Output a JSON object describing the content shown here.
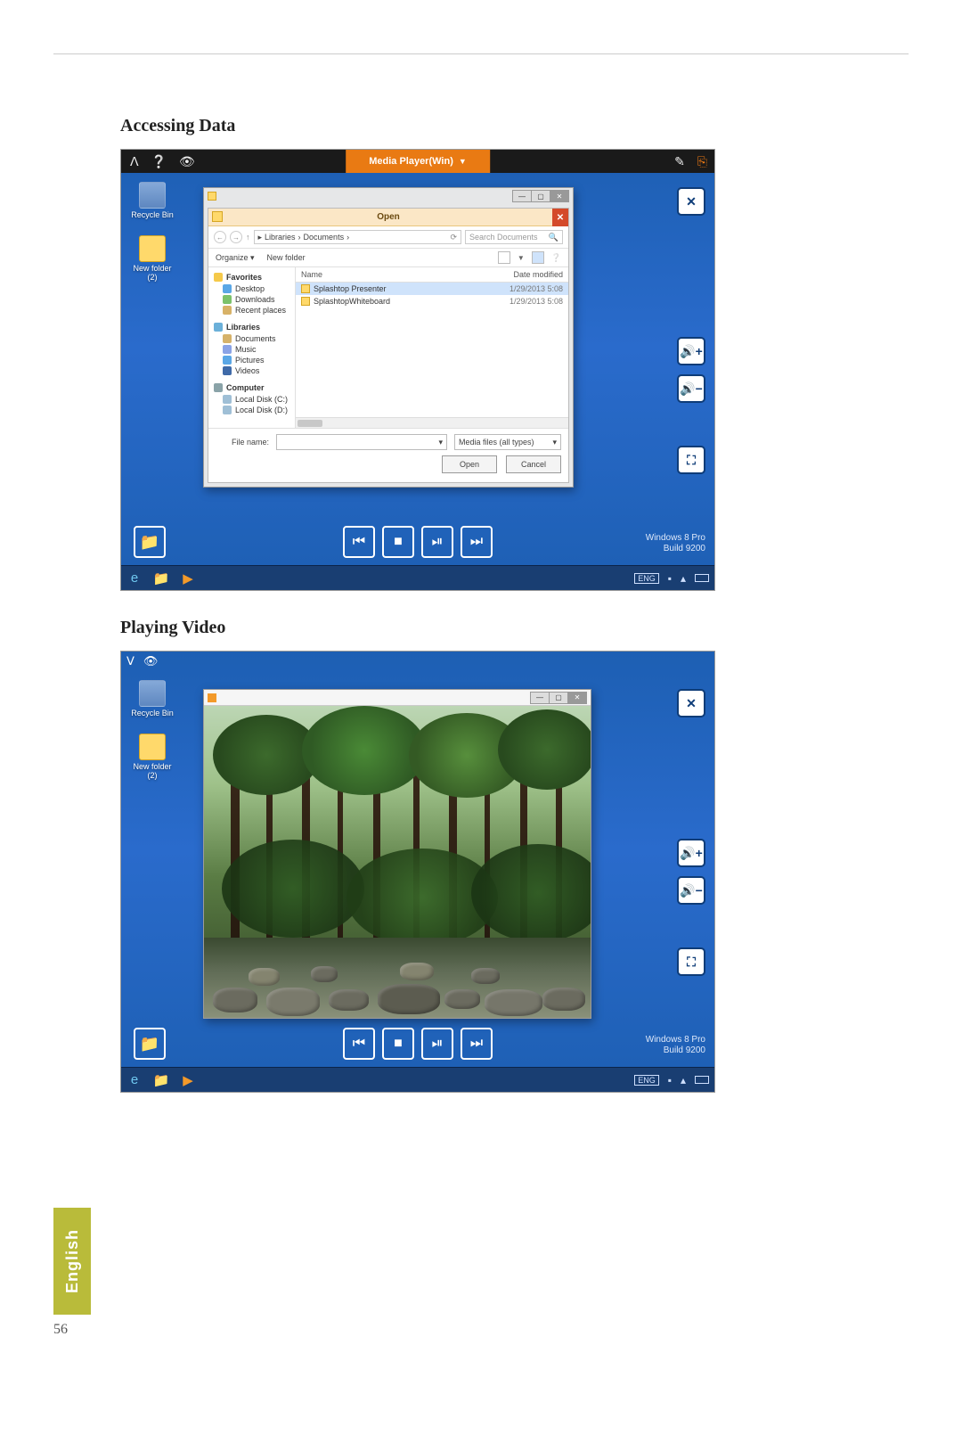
{
  "headings": {
    "accessing_data": "Accessing Data",
    "playing_video": "Playing Video"
  },
  "page_number": "56",
  "language_tab": "English",
  "screenshot1": {
    "topbar_title": "Media Player(Win)",
    "desktop": {
      "recycle_bin": "Recycle Bin",
      "new_folder": "New folder (2)"
    },
    "dialog": {
      "title": "Open",
      "breadcrumb_parts": [
        "Libraries",
        "Documents"
      ],
      "breadcrumb_sep": "›",
      "search_placeholder": "Search Documents",
      "refresh_label": "⟳",
      "toolbar": {
        "organize": "Organize ▾",
        "new_folder": "New folder"
      },
      "tree": {
        "favorites": "Favorites",
        "desktop": "Desktop",
        "downloads": "Downloads",
        "recent": "Recent places",
        "libraries": "Libraries",
        "documents": "Documents",
        "music": "Music",
        "pictures": "Pictures",
        "videos": "Videos",
        "computer": "Computer",
        "local_c": "Local Disk (C:)",
        "local_d": "Local Disk (D:)"
      },
      "columns": {
        "name": "Name",
        "date": "Date modified"
      },
      "files": [
        {
          "name": "Splashtop Presenter",
          "date": "1/29/2013 5:08"
        },
        {
          "name": "SplashtopWhiteboard",
          "date": "1/29/2013 5:08"
        }
      ],
      "file_name_label": "File name:",
      "filter": "Media files (all types)",
      "filter_caret": "▾",
      "open_btn": "Open",
      "cancel_btn": "Cancel"
    },
    "watermark": {
      "line1": "Windows 8 Pro",
      "line2": "Build 9200"
    },
    "side_buttons": {
      "close": "✕",
      "vol_up": "🔊+",
      "vol_down": "🔊−",
      "fullscreen": "⛶"
    }
  },
  "screenshot2": {
    "desktop": {
      "recycle_bin": "Recycle Bin",
      "new_folder": "New folder (2)"
    },
    "watermark": {
      "line1": "Windows 8 Pro",
      "line2": "Build 9200"
    },
    "side_buttons": {
      "close": "✕",
      "vol_up": "🔊+",
      "vol_down": "🔊−",
      "fullscreen": "⛶"
    }
  }
}
